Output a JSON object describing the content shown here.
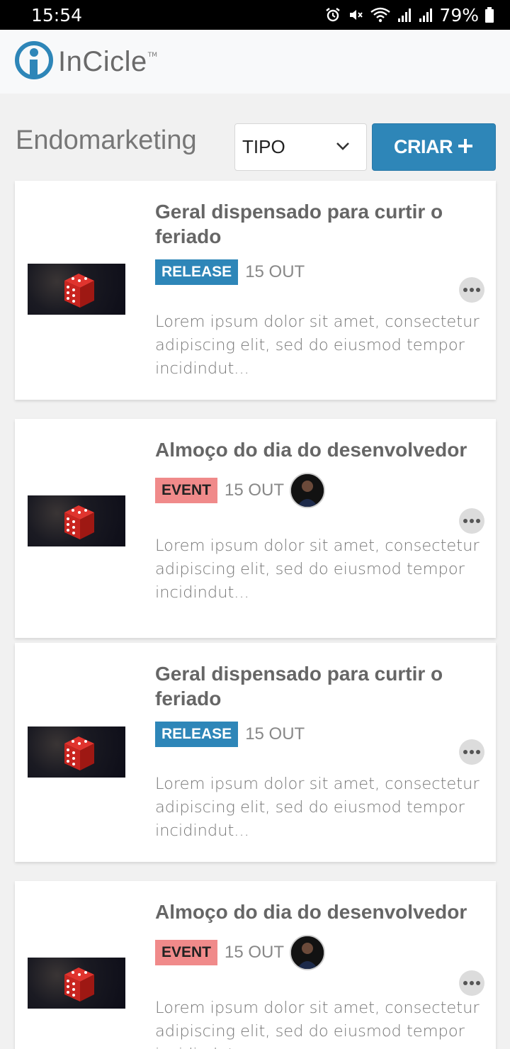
{
  "status_bar": {
    "time": "15:54",
    "battery": "79%",
    "icons": [
      "alarm-icon",
      "mute-icon",
      "wifi-icon",
      "signal-icon",
      "signal-icon",
      "battery-icon"
    ]
  },
  "app": {
    "brand": "InCicle",
    "trademark": "TM"
  },
  "page": {
    "title": "Endomarketing",
    "type_filter": {
      "value": "TIPO"
    },
    "create_button": {
      "label": "CRIAR"
    }
  },
  "posts": [
    {
      "title": "Geral dispensado para curtir o feriado",
      "tag": "RELEASE",
      "date": "15 OUT",
      "excerpt": "Lorem ipsum dolor sit amet, consectetur adipiscing elit, sed do eiusmod tempor incidindut..."
    },
    {
      "title": "Almoço do dia do desenvolvedor",
      "tag": "EVENT",
      "date": "15 OUT",
      "excerpt": "Lorem ipsum dolor sit amet, consectetur adipiscing elit, sed do eiusmod tempor incidindut..."
    },
    {
      "title": "Geral dispensado para curtir o feriado",
      "tag": "RELEASE",
      "date": "15 OUT",
      "excerpt": "Lorem ipsum dolor sit amet, consectetur adipiscing elit, sed do eiusmod tempor incidindut..."
    },
    {
      "title": "Almoço do dia do desenvolvedor",
      "tag": "EVENT",
      "date": "15 OUT",
      "excerpt": "Lorem ipsum dolor sit amet, consectetur adipiscing elit, sed do eiusmod tempor incidindut..."
    }
  ],
  "colors": {
    "primary": "#2e86b8",
    "event_tag": "#f08a8a"
  }
}
